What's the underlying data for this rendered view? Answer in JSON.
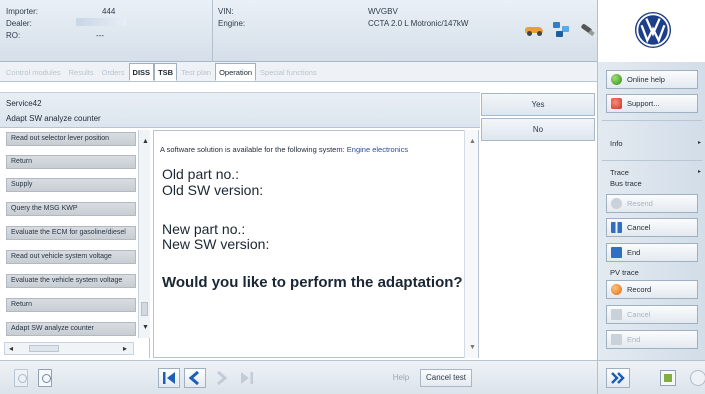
{
  "header": {
    "importer_label": "Importer:",
    "importer_value": "444",
    "dealer_label": "Dealer:",
    "ro_label": "RO:",
    "ro_value": "---",
    "vin_label": "VIN:",
    "vin_value": "WVGBV",
    "engine_label": "Engine:",
    "engine_value": "CCTA 2.0 L Motronic/147kW"
  },
  "tabs": [
    {
      "label": "Control modules"
    },
    {
      "label": "Results"
    },
    {
      "label": "Orders"
    },
    {
      "label": "DISS"
    },
    {
      "label": "TSB"
    },
    {
      "label": "Test plan"
    },
    {
      "label": "Operation"
    },
    {
      "label": "Special functions"
    }
  ],
  "title": {
    "line1": "Service42",
    "line2": "Adapt SW analyze counter"
  },
  "actions": {
    "yes": "Yes",
    "no": "No"
  },
  "list_items": [
    "Read out selector lever position",
    "Return",
    "Supply",
    "Query the MSG KWP",
    "Evaluate the ECM for gasoline/diesel",
    "Read out vehicle system voltage",
    "Evaluate the vehicle system voltage",
    "Return",
    "Adapt SW analyze counter"
  ],
  "content": {
    "intro": "A software solution is available for the following system:",
    "system": "Engine electronics",
    "old_part": "Old part no.:",
    "old_sw": "Old SW version:",
    "new_part": "New part no.:",
    "new_sw": "New SW version:",
    "question": "Would you like to perform the adaptation?"
  },
  "bottom": {
    "help": "Help",
    "cancel_test": "Cancel test"
  },
  "right_panel": {
    "online_help": "Online help",
    "support": "Support...",
    "info": "Info",
    "trace": "Trace",
    "bus_trace": "Bus trace",
    "resend": "Resend",
    "cancel": "Cancel",
    "end": "End",
    "pv_trace": "PV trace",
    "record": "Record",
    "pv_cancel": "Cancel",
    "pv_end": "End"
  },
  "icons": {
    "car": "car-icon",
    "network": "network-icon",
    "cable": "cable-icon",
    "logo": "vw-logo"
  },
  "colors": {
    "vw_blue": "#1d3f88",
    "link_blue": "#2a4d9a",
    "nav_blue": "#1c5fb5"
  }
}
